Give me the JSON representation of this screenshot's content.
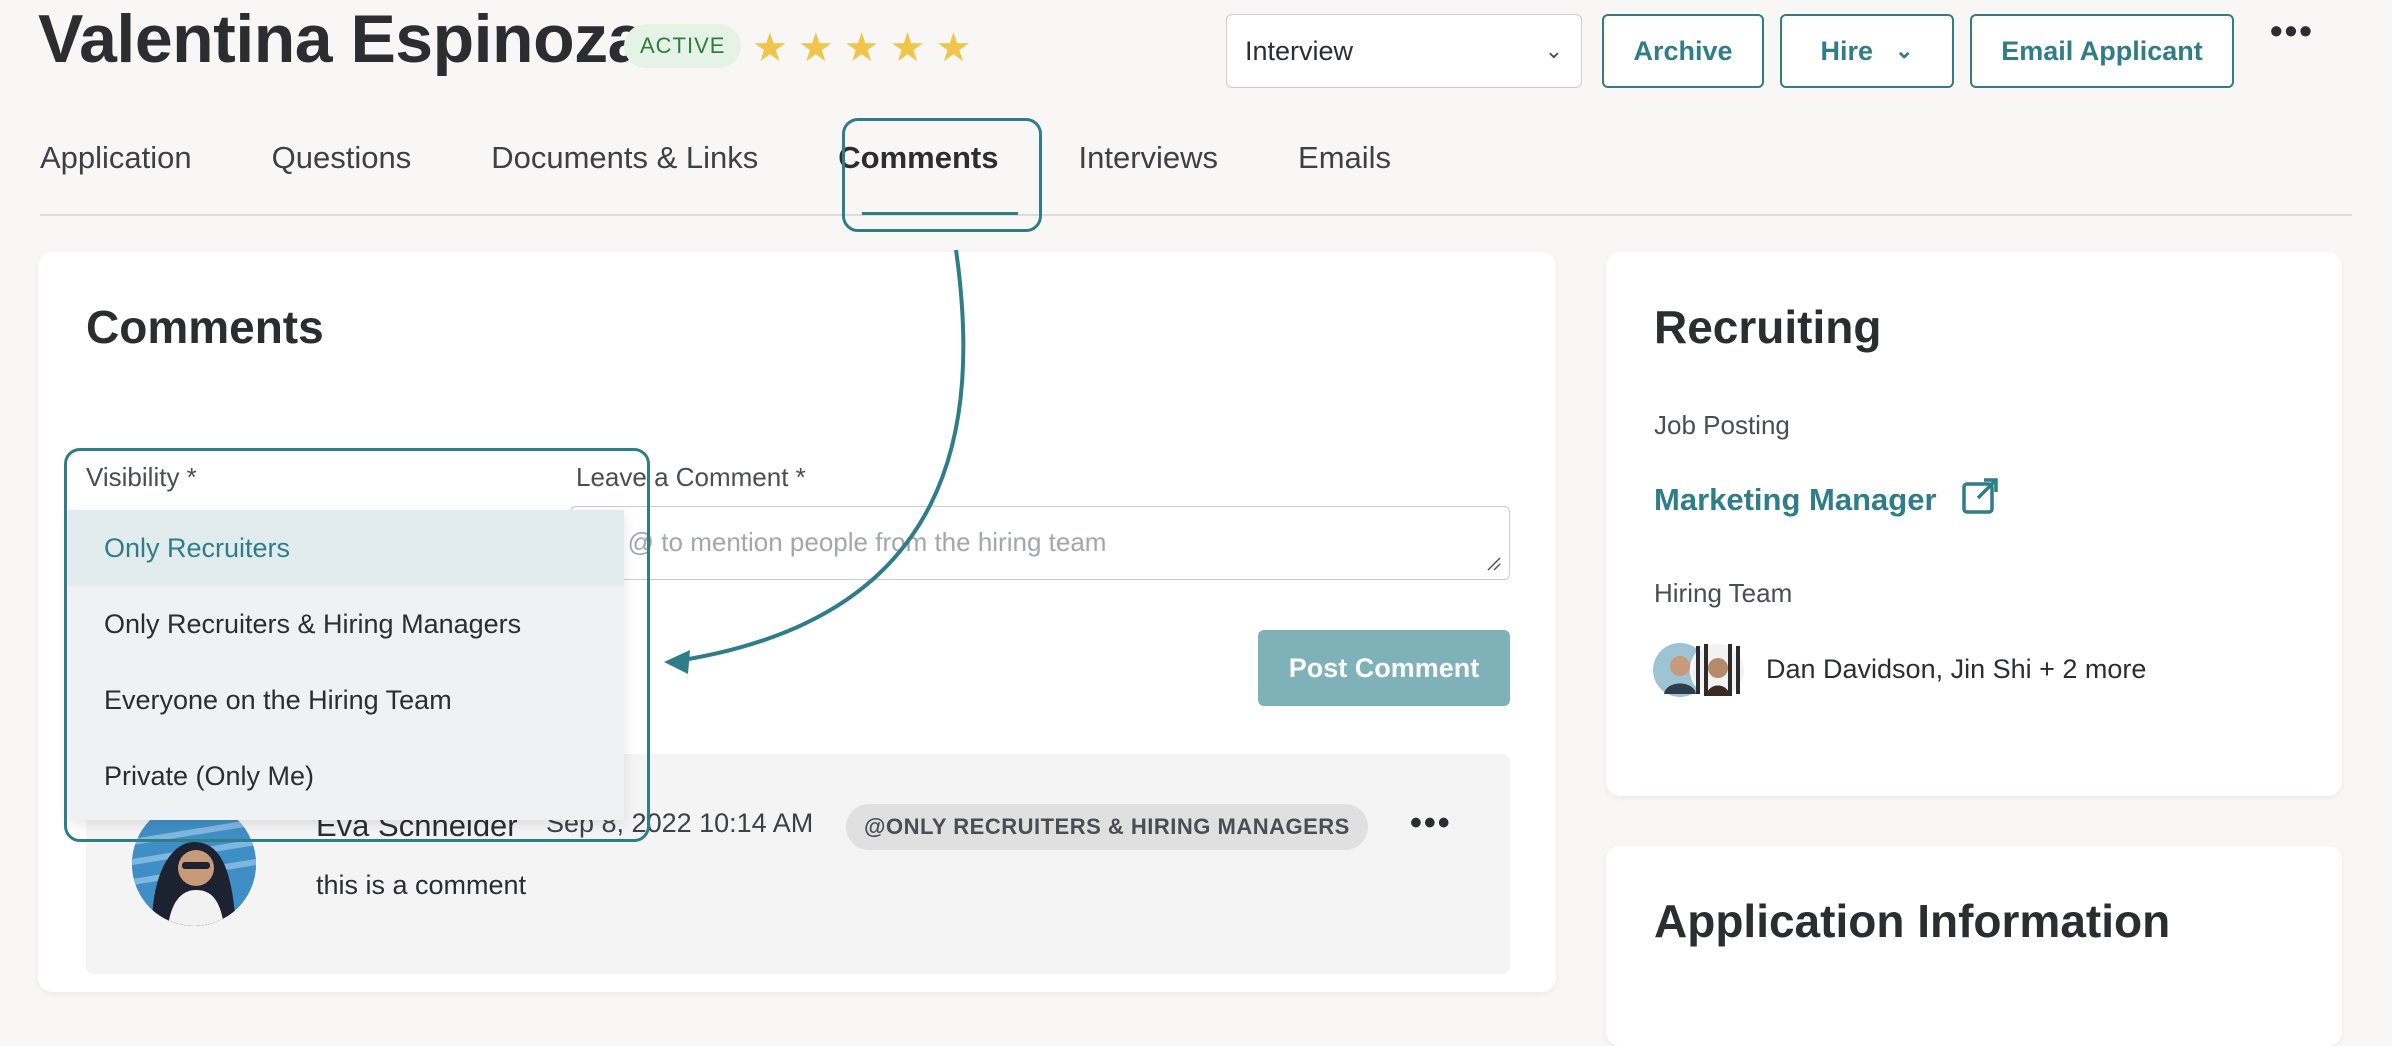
{
  "header": {
    "candidate_name": "Valentina Espinoza",
    "status": "ACTIVE",
    "rating_stars": 5,
    "stage_select": "Interview",
    "archive_label": "Archive",
    "hire_label": "Hire",
    "email_label": "Email Applicant"
  },
  "tabs": [
    {
      "label": "Application"
    },
    {
      "label": "Questions"
    },
    {
      "label": "Documents & Links"
    },
    {
      "label": "Comments"
    },
    {
      "label": "Interviews"
    },
    {
      "label": "Emails"
    }
  ],
  "comments": {
    "title": "Comments",
    "visibility_label": "Visibility *",
    "leave_comment_label": "Leave a Comment *",
    "comment_placeholder": "Type @ to mention people from the hiring team",
    "comment_placeholder_visible": "se @ to mention people from the hiring team",
    "post_label": "Post Comment",
    "visibility_options": [
      "Only Recruiters",
      "Only Recruiters & Hiring Managers",
      "Everyone on the Hiring Team",
      "Private (Only Me)"
    ],
    "selected_option": "Only Recruiters",
    "entry": {
      "author": "Eva Schneider",
      "timestamp": "Sep 8, 2022 10:14 AM",
      "visibility_badge": "@ONLY RECRUITERS & HIRING MANAGERS",
      "text": "this is a comment"
    }
  },
  "recruiting": {
    "title": "Recruiting",
    "job_posting_label": "Job Posting",
    "job_posting": "Marketing Manager",
    "hiring_team_label": "Hiring Team",
    "hiring_team": "Dan Davidson, Jin Shi + 2 more"
  },
  "application_info": {
    "title": "Application Information"
  },
  "colors": {
    "accent": "#2f7d87",
    "star": "#f1c44b",
    "active_badge_bg": "#e4f3e5",
    "post_button": "#7fb1b9"
  }
}
